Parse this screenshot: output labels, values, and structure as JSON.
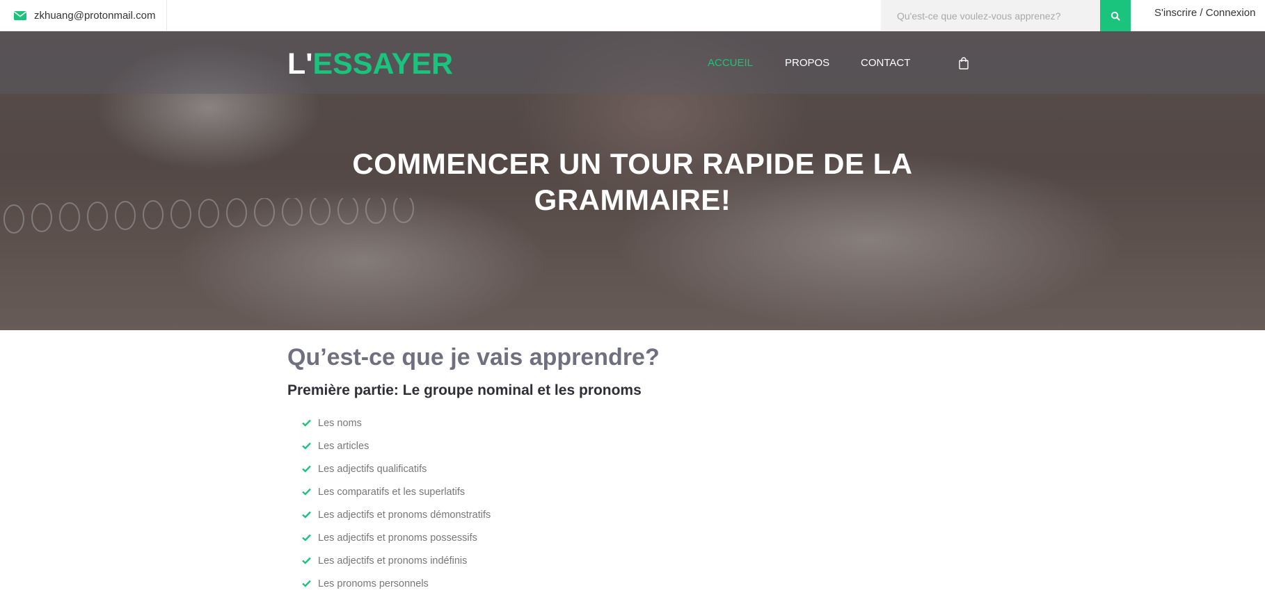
{
  "topbar": {
    "email": "zkhuang@protonmail.com",
    "search_placeholder": "Qu'est-ce que voulez-vous apprenez?",
    "signup": "S'inscrire",
    "separator": "/",
    "login": "Connexion"
  },
  "header": {
    "logo_prefix": "L'",
    "logo_main": "ESSAYER",
    "nav": [
      "ACCUEIL",
      "PROPOS",
      "CONTACT"
    ],
    "active_nav": "ACCUEIL"
  },
  "hero": {
    "title_line1": "COMMENCER UN TOUR RAPIDE DE LA",
    "title_line2": "GRAMMAIRE!"
  },
  "main": {
    "heading": "Qu’est-ce que je vais apprendre?",
    "part_title": "Première partie: Le groupe nominal et les pronoms",
    "topics": [
      "Les noms",
      "Les articles",
      "Les adjectifs qualificatifs",
      "Les comparatifs et les superlatifs",
      "Les adjectifs et pronoms démonstratifs",
      "Les adjectifs et pronoms possessifs",
      "Les adjectifs et pronoms indéfinis",
      "Les pronoms personnels"
    ]
  },
  "icons": {
    "email": "envelope-icon",
    "search": "search-icon",
    "cart": "shopping-bag-icon",
    "check": "check-icon"
  },
  "colors": {
    "accent": "#1bc47d",
    "heading": "#6f6f80"
  }
}
